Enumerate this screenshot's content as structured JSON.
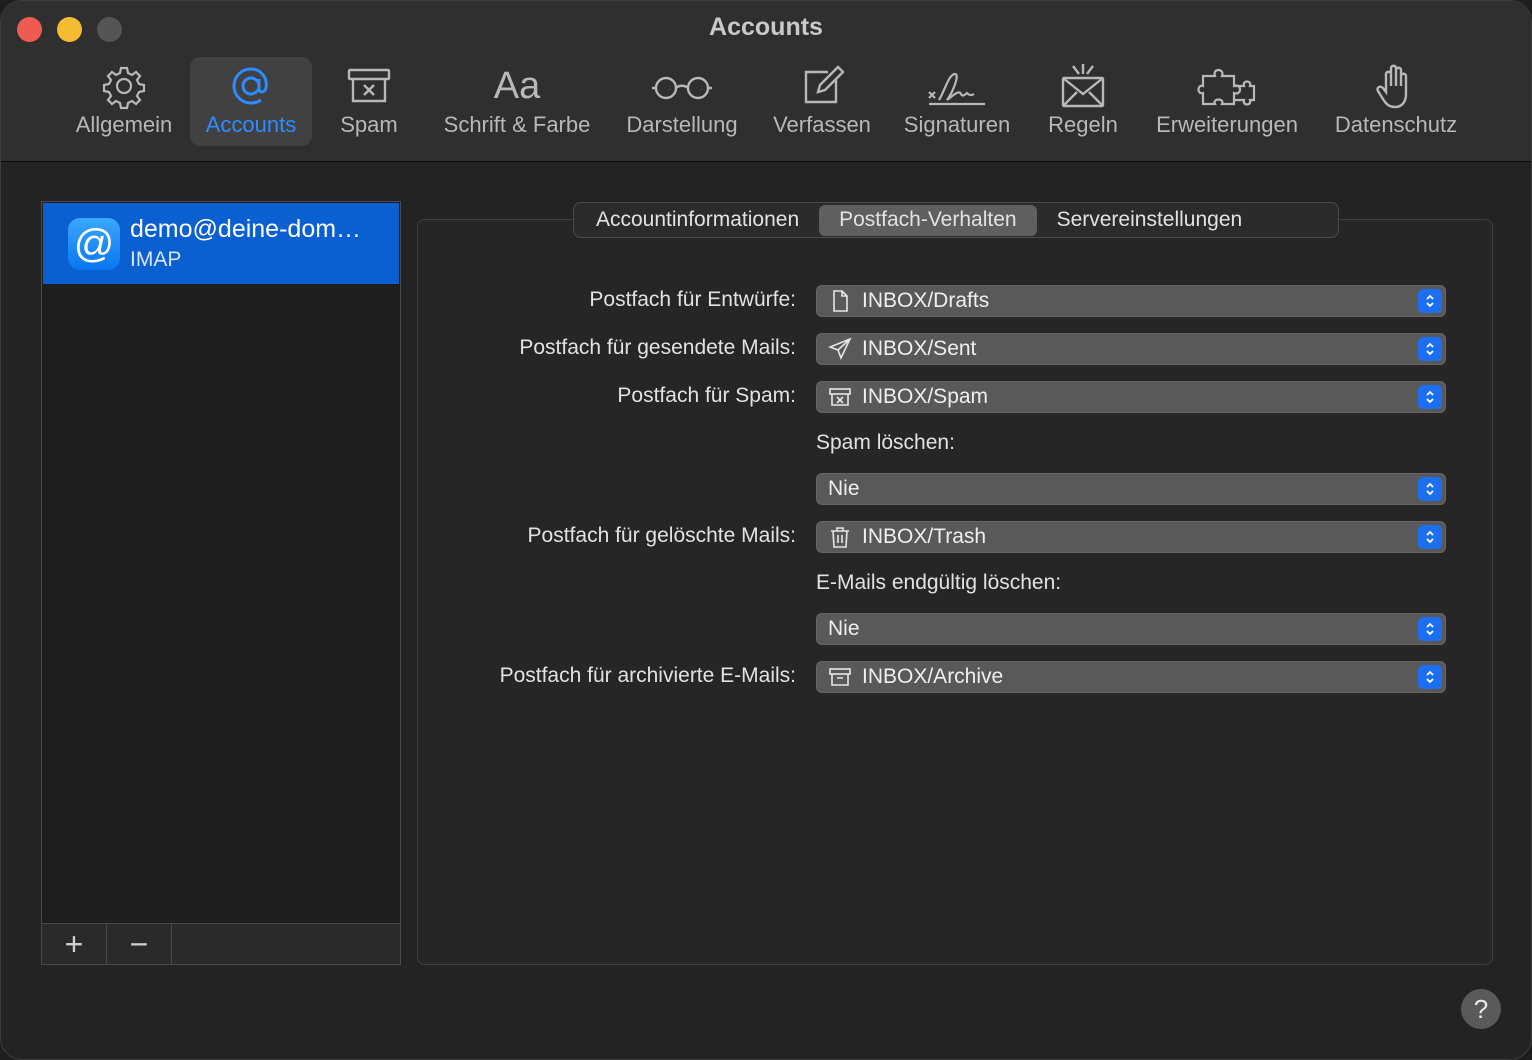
{
  "window": {
    "title": "Accounts"
  },
  "toolbar": {
    "items": [
      {
        "label": "Allgemein",
        "icon": "gear-icon"
      },
      {
        "label": "Accounts",
        "icon": "at-sign-icon",
        "selected": true
      },
      {
        "label": "Spam",
        "icon": "junk-box-icon"
      },
      {
        "label": "Schrift & Farbe",
        "icon": "font-icon",
        "glyph": "Aa"
      },
      {
        "label": "Darstellung",
        "icon": "glasses-icon"
      },
      {
        "label": "Verfassen",
        "icon": "compose-icon"
      },
      {
        "label": "Signaturen",
        "icon": "signature-icon"
      },
      {
        "label": "Regeln",
        "icon": "rules-envelope-icon"
      },
      {
        "label": "Erweiterungen",
        "icon": "puzzle-icon"
      },
      {
        "label": "Datenschutz",
        "icon": "hand-icon"
      }
    ]
  },
  "accounts": {
    "items": [
      {
        "name": "demo@deine-dom…",
        "type": "IMAP",
        "icon_glyph": "@"
      }
    ],
    "add_glyph": "+",
    "remove_glyph": "−"
  },
  "tabs": [
    {
      "label": "Accountinformationen"
    },
    {
      "label": "Postfach-Verhalten",
      "active": true
    },
    {
      "label": "Servereinstellungen"
    }
  ],
  "settings": {
    "drafts": {
      "label": "Postfach für Entwürfe:",
      "value": "INBOX/Drafts",
      "icon": "document-icon"
    },
    "sent": {
      "label": "Postfach für gesendete Mails:",
      "value": "INBOX/Sent",
      "icon": "paper-plane-icon"
    },
    "spam": {
      "label": "Postfach für Spam:",
      "value": "INBOX/Spam",
      "icon": "junk-box-icon"
    },
    "spam_delete": {
      "label": "Spam löschen:",
      "value": "Nie"
    },
    "trash": {
      "label": "Postfach für gelöschte Mails:",
      "value": "INBOX/Trash",
      "icon": "trash-icon"
    },
    "erase": {
      "label": "E-Mails endgültig löschen:",
      "value": "Nie"
    },
    "archive": {
      "label": "Postfach für archivierte E-Mails:",
      "value": "INBOX/Archive",
      "icon": "archive-box-icon"
    }
  },
  "help": {
    "glyph": "?"
  },
  "colors": {
    "accent": "#1d6ff2",
    "selection": "#0a5fd1",
    "selected_label": "#2d8cff"
  }
}
